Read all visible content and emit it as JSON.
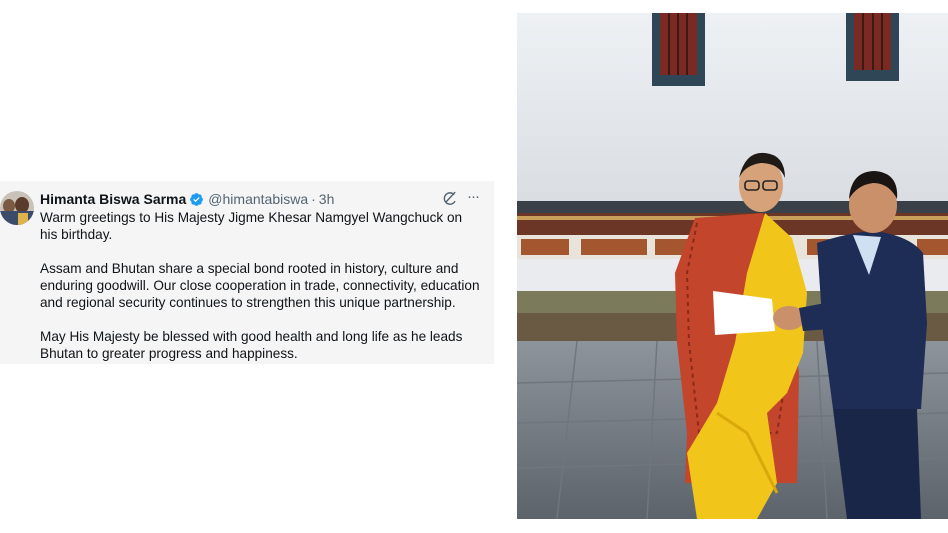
{
  "tweet": {
    "author_name": "Himanta Biswa Sarma",
    "handle": "@himantabiswa",
    "separator": "·",
    "time": "3h",
    "paragraphs": [
      "Warm greetings to His Majesty Jigme Khesar Namgyel Wangchuck on his birthday.",
      "Assam and Bhutan share a special bond rooted in history, culture and enduring goodwill. Our close cooperation in trade, connectivity, education and regional security continues to strengthen this unique partnership.",
      "May His Majesty be blessed with good health and long life as he leads Bhutan to greater progress and happiness."
    ],
    "more_label": "···",
    "icons": [
      "verified-badge-icon",
      "grok-icon",
      "more-icon"
    ],
    "colors": {
      "verified": "#1d9bf0",
      "text": "#0f1419",
      "muted": "#536471",
      "background": "#f5f5f5"
    }
  },
  "photo": {
    "subject": "handshake-photo"
  }
}
